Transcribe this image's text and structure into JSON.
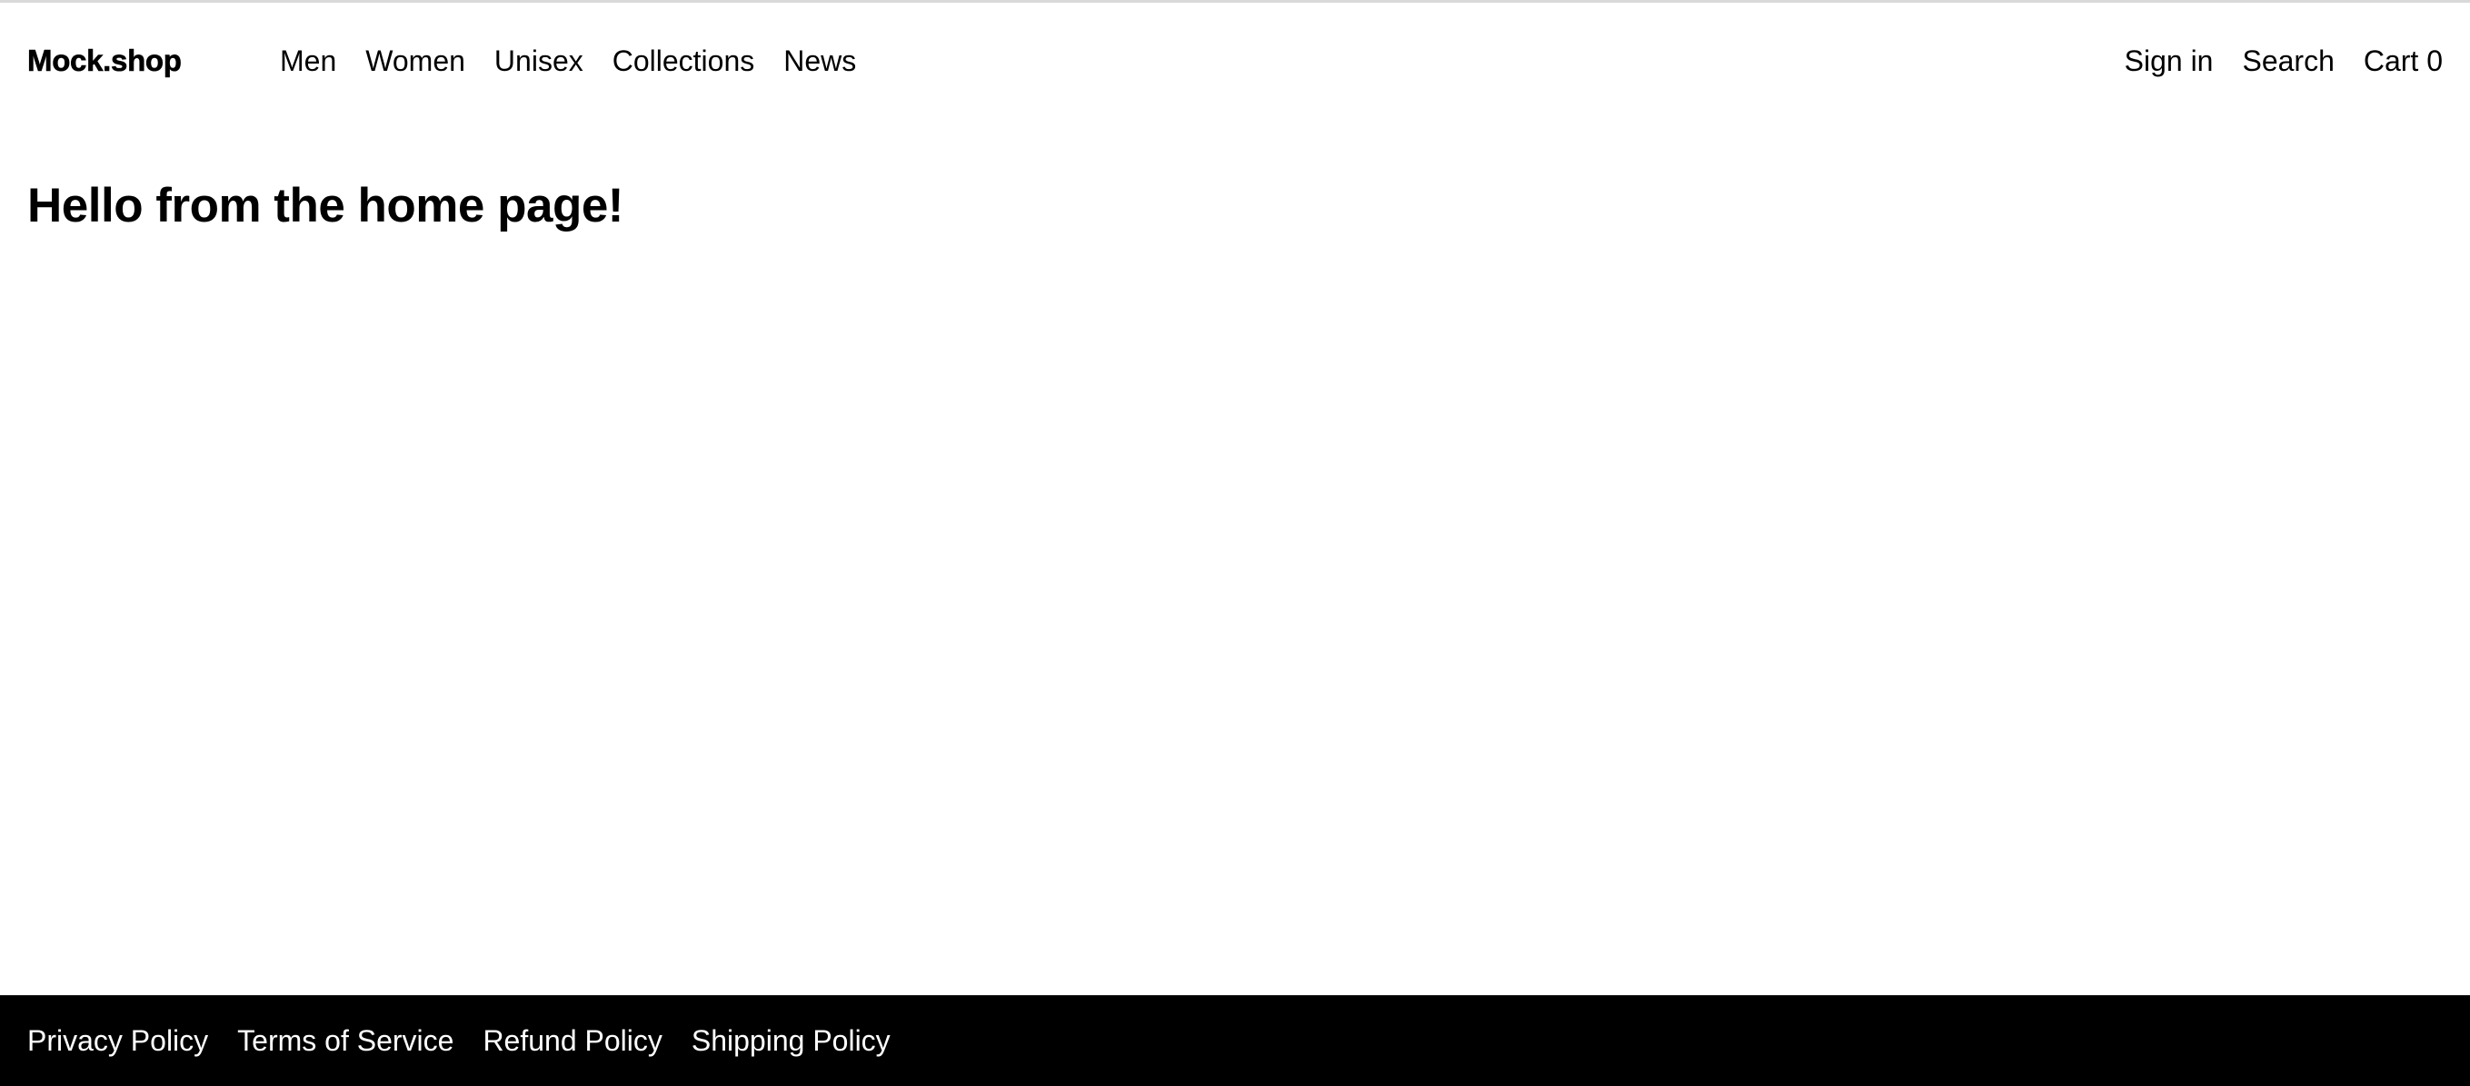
{
  "header": {
    "logo": "Mock.shop",
    "nav": [
      {
        "label": "Men"
      },
      {
        "label": "Women"
      },
      {
        "label": "Unisex"
      },
      {
        "label": "Collections"
      },
      {
        "label": "News"
      }
    ],
    "account": {
      "sign_in": "Sign in",
      "search": "Search",
      "cart": "Cart 0"
    }
  },
  "main": {
    "title": "Hello from the home page!"
  },
  "footer": {
    "links": [
      {
        "label": "Privacy Policy"
      },
      {
        "label": "Terms of Service"
      },
      {
        "label": "Refund Policy"
      },
      {
        "label": "Shipping Policy"
      }
    ]
  },
  "colors": {
    "background": "#ffffff",
    "text": "#000000",
    "footer_background": "#000000",
    "footer_text": "#ffffff",
    "top_rule": "#d9d9d9"
  }
}
